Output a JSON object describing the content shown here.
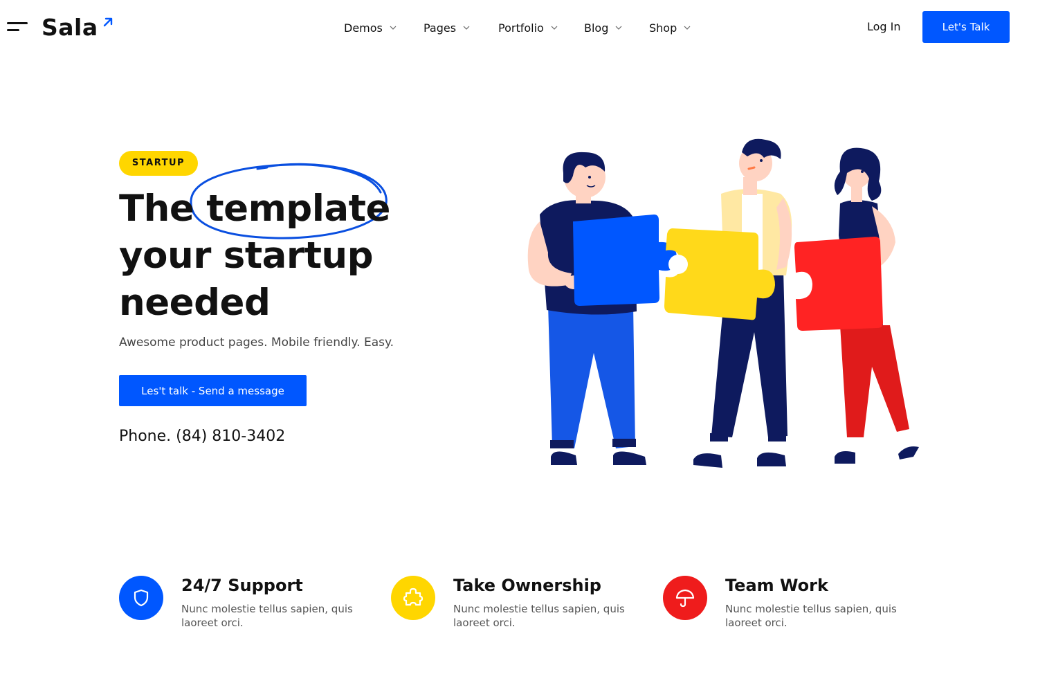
{
  "header": {
    "logo": "Sala",
    "nav": [
      {
        "label": "Demos"
      },
      {
        "label": "Pages"
      },
      {
        "label": "Portfolio"
      },
      {
        "label": "Blog"
      },
      {
        "label": "Shop"
      }
    ],
    "login_label": "Log In",
    "cta_label": "Let's Talk"
  },
  "hero": {
    "badge": "STARTUP",
    "headline_line1_a": "The",
    "headline_line1_b": "template",
    "headline_line2": "your startup",
    "headline_line3": "needed",
    "subtext": "Awesome product pages. Mobile friendly. Easy.",
    "cta_label": "Les't talk - Send a message",
    "phone": "Phone. (84) 810-3402"
  },
  "features": [
    {
      "title": "24/7 Support",
      "desc": "Nunc molestie tellus sapien, quis laoreet orci.",
      "icon": "shield-icon",
      "color": "#0057ff"
    },
    {
      "title": "Take Ownership",
      "desc": "Nunc molestie tellus sapien, quis laoreet orci.",
      "icon": "puzzle-icon",
      "color": "#ffd600"
    },
    {
      "title": "Team Work",
      "desc": "Nunc molestie tellus sapien, quis laoreet orci.",
      "icon": "umbrella-icon",
      "color": "#ef1c1c"
    }
  ],
  "colors": {
    "accent": "#0057ff",
    "yellow": "#ffd600",
    "red": "#ef1c1c",
    "navy": "#0e1a5e"
  }
}
